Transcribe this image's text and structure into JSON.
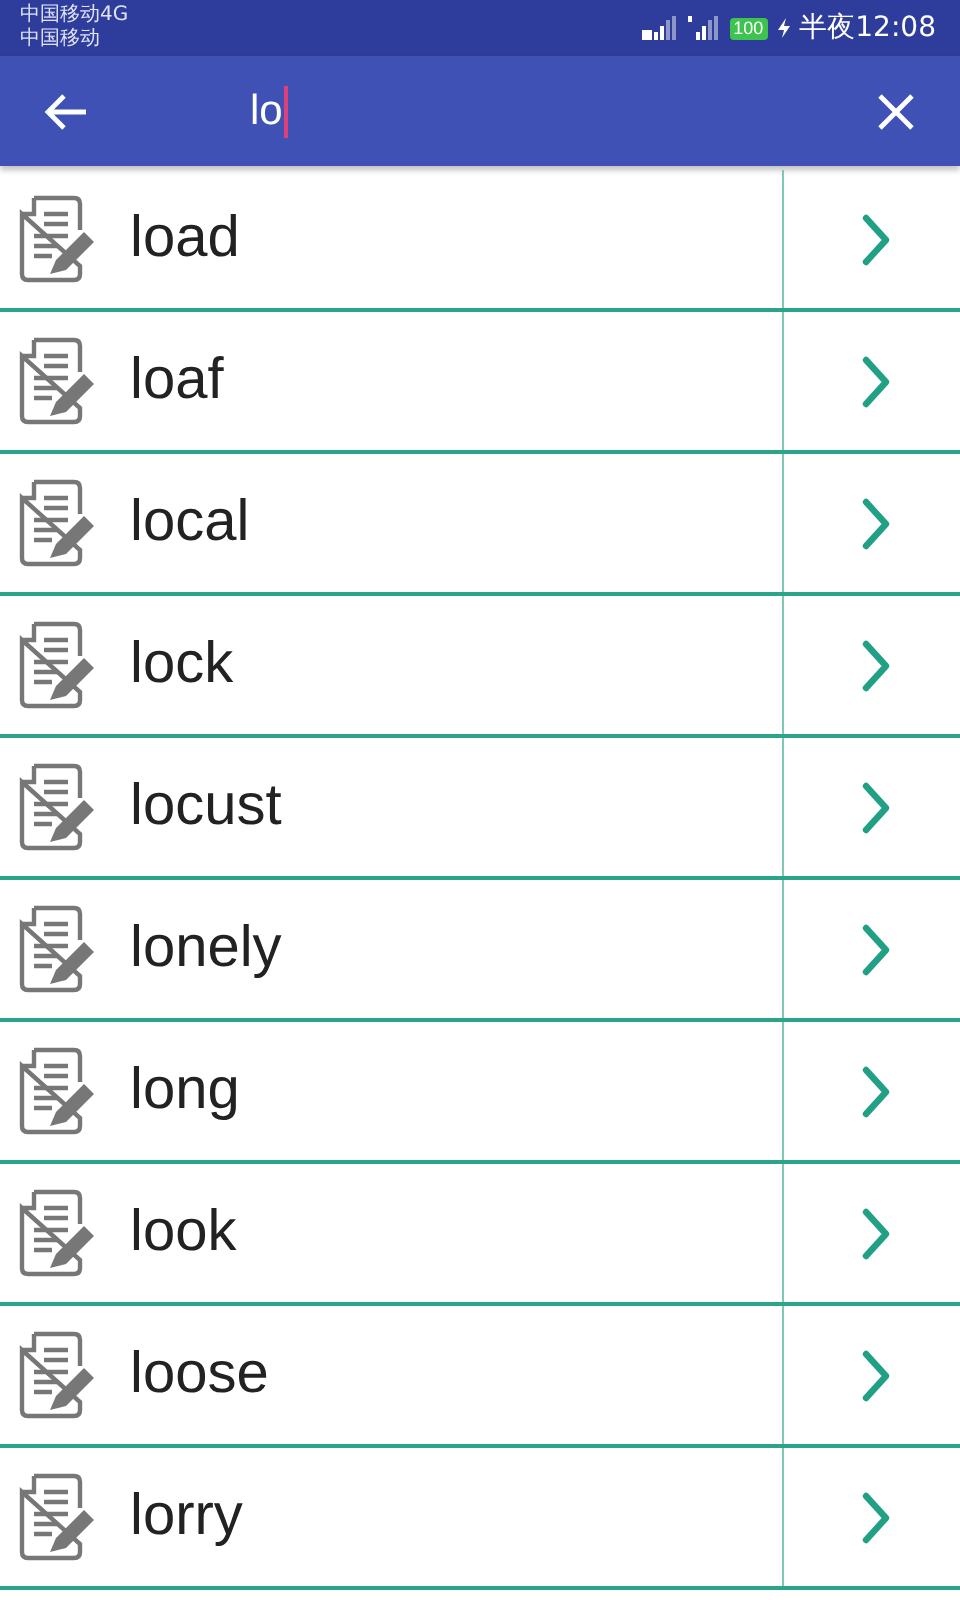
{
  "status_bar": {
    "carriers": [
      "中国移动4G",
      "中国移动"
    ],
    "battery": "100",
    "time": "半夜12:08"
  },
  "search": {
    "value": "lo"
  },
  "results": [
    {
      "word": "load"
    },
    {
      "word": "loaf"
    },
    {
      "word": "local"
    },
    {
      "word": "lock"
    },
    {
      "word": "locust"
    },
    {
      "word": "lonely"
    },
    {
      "word": "long"
    },
    {
      "word": "look"
    },
    {
      "word": "loose"
    },
    {
      "word": "lorry"
    }
  ]
}
